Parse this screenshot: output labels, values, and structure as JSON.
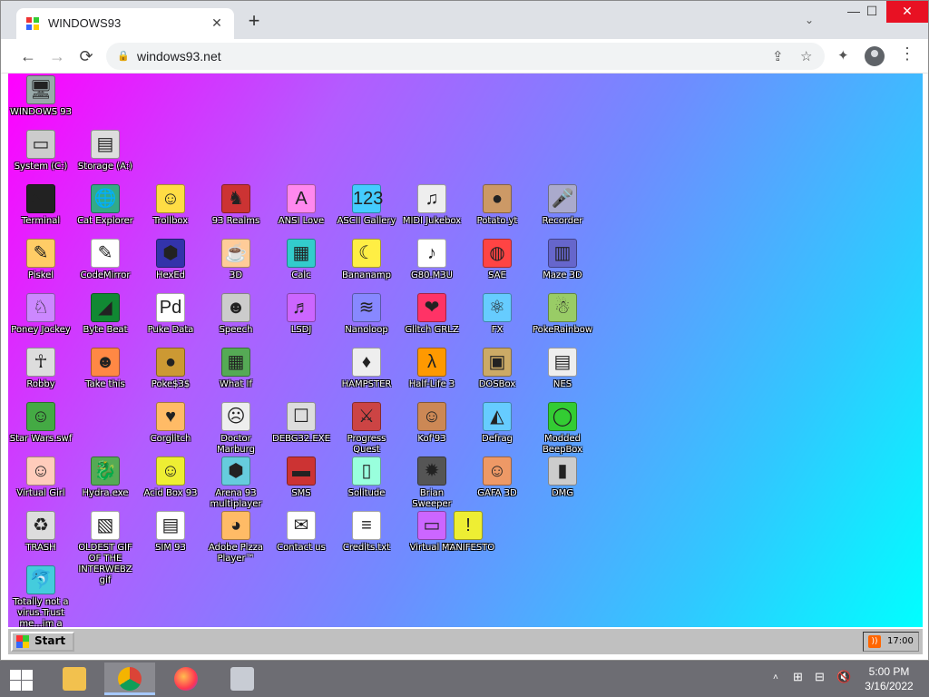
{
  "browser": {
    "tab_title": "WINDOWS93",
    "tab_close_glyph": "✕",
    "new_tab_glyph": "+",
    "tab_dropdown_glyph": "⌄",
    "url": "windows93.net",
    "window_controls": {
      "minimize": "—",
      "maximize": "☐",
      "close": "✕"
    },
    "nav": {
      "back": "←",
      "forward": "→",
      "reload": "⟳"
    },
    "icons": [
      "share-icon",
      "bookmark-star-icon",
      "extensions-icon",
      "profile-icon",
      "menu-kebab-icon"
    ],
    "glyphs": {
      "lock": "🔒",
      "share": "⇪",
      "star": "☆",
      "puzzle": "✦",
      "menu": "⋮"
    }
  },
  "desktop": {
    "background_colors": [
      "#ff00ff",
      "#00ffff"
    ],
    "icons": [
      {
        "label": "WINDOWS 93",
        "glyph": "🖥",
        "color": "#9aa"
      },
      {
        "label": "System (C:)",
        "glyph": "▭",
        "color": "#ccc"
      },
      {
        "label": "Storage (A:)",
        "glyph": "▤",
        "color": "#ddd"
      },
      {
        "label": "Terminal",
        "glyph": ">_",
        "color": "#222"
      },
      {
        "label": "Cat Explorer",
        "glyph": "🌐",
        "color": "#3a8"
      },
      {
        "label": "Trollbox",
        "glyph": "☺",
        "color": "#fd4"
      },
      {
        "label": "93 Realms",
        "glyph": "♞",
        "color": "#c33"
      },
      {
        "label": "ANSI Love",
        "glyph": "A",
        "color": "#f8e"
      },
      {
        "label": "ASCII Gallery",
        "glyph": "123",
        "color": "#4cf"
      },
      {
        "label": "MIDI Jukebox",
        "glyph": "♫",
        "color": "#eee"
      },
      {
        "label": "Potato.yt",
        "glyph": "●",
        "color": "#c96"
      },
      {
        "label": "Recorder",
        "glyph": "🎤",
        "color": "#aac"
      },
      {
        "label": "Piskel",
        "glyph": "✎",
        "color": "#fc6"
      },
      {
        "label": "CodeMirror",
        "glyph": "✎",
        "color": "#fff"
      },
      {
        "label": "HexEd",
        "glyph": "⬢",
        "color": "#33a"
      },
      {
        "label": "3D",
        "glyph": "☕",
        "color": "#fc9"
      },
      {
        "label": "Calc",
        "glyph": "▦",
        "color": "#3cc"
      },
      {
        "label": "Bananamp",
        "glyph": "☾",
        "color": "#fe4"
      },
      {
        "label": "G80.M3U",
        "glyph": "♪",
        "color": "#fff"
      },
      {
        "label": "SAE",
        "glyph": "◍",
        "color": "#f44"
      },
      {
        "label": "Maze 3D",
        "glyph": "▥",
        "color": "#66c"
      },
      {
        "label": "Poney Jockey",
        "glyph": "♘",
        "color": "#c8f"
      },
      {
        "label": "Byte Beat",
        "glyph": "◢",
        "color": "#183"
      },
      {
        "label": "Puke Data",
        "glyph": "Pd",
        "color": "#fff"
      },
      {
        "label": "Speech",
        "glyph": "☻",
        "color": "#ccc"
      },
      {
        "label": "LSDJ",
        "glyph": "♬",
        "color": "#c6f"
      },
      {
        "label": "Nanoloop",
        "glyph": "≋",
        "color": "#88f"
      },
      {
        "label": "Glitch GRLZ",
        "glyph": "❤",
        "color": "#f36"
      },
      {
        "label": "FX",
        "glyph": "⚛",
        "color": "#6cf"
      },
      {
        "label": "PokeRainbow",
        "glyph": "☃",
        "color": "#9c6"
      },
      {
        "label": "Robby",
        "glyph": "☥",
        "color": "#ddd"
      },
      {
        "label": "Take this",
        "glyph": "☻",
        "color": "#f84"
      },
      {
        "label": "Poke$3$",
        "glyph": "●",
        "color": "#c93"
      },
      {
        "label": "What If",
        "glyph": "▦",
        "color": "#5a5"
      },
      {
        "label": "HAMPSTER",
        "glyph": "♦",
        "color": "#eee"
      },
      {
        "label": "Half-Life 3",
        "glyph": "λ",
        "color": "#f90"
      },
      {
        "label": "DOSBox",
        "glyph": "▣",
        "color": "#ca6"
      },
      {
        "label": "NES",
        "glyph": "▤",
        "color": "#eee"
      },
      {
        "label": "Star Wars.swf",
        "glyph": "☺",
        "color": "#4a4"
      },
      {
        "label": "Corglitch",
        "glyph": "♥",
        "color": "#fb6"
      },
      {
        "label": "Doctor Marburg",
        "glyph": "☹",
        "color": "#eee"
      },
      {
        "label": "DEBG32.EXE",
        "glyph": "☐",
        "color": "#ddd"
      },
      {
        "label": "Progress Quest",
        "glyph": "⚔",
        "color": "#c44"
      },
      {
        "label": "Kof'93",
        "glyph": "☺",
        "color": "#c85"
      },
      {
        "label": "Defrag",
        "glyph": "◭",
        "color": "#6cf"
      },
      {
        "label": "Modded BeepBox",
        "glyph": "◯",
        "color": "#3c3"
      },
      {
        "label": "Virtual Girl",
        "glyph": "☺",
        "color": "#fcb"
      },
      {
        "label": "Hydra.exe",
        "glyph": "🐉",
        "color": "#5a5"
      },
      {
        "label": "Acid Box 93",
        "glyph": "☺",
        "color": "#ee3"
      },
      {
        "label": "Arena 93 multiplayer",
        "glyph": "⬢",
        "color": "#6cd"
      },
      {
        "label": "SMS",
        "glyph": "▬",
        "color": "#c33"
      },
      {
        "label": "Solitude",
        "glyph": "▯",
        "color": "#9fd"
      },
      {
        "label": "Brian Sweeper",
        "glyph": "✹",
        "color": "#555"
      },
      {
        "label": "GAFA 3D",
        "glyph": "☺",
        "color": "#e96"
      },
      {
        "label": "DMG",
        "glyph": "▮",
        "color": "#ccc"
      },
      {
        "label": "TRASH",
        "glyph": "♻",
        "color": "#ddd"
      },
      {
        "label": "OLDEST GIF OF THE INTERWEBZ gif",
        "glyph": "▧",
        "color": "#fff"
      },
      {
        "label": "SIM 93",
        "glyph": "▤",
        "color": "#fff"
      },
      {
        "label": "Adobe Pizza Player™",
        "glyph": "◕",
        "color": "#fb6"
      },
      {
        "label": "Contact us",
        "glyph": "✉",
        "color": "#fff"
      },
      {
        "label": "Credits.txt",
        "glyph": "≡",
        "color": "#fff"
      },
      {
        "label": "Virtual PC",
        "glyph": "▭",
        "color": "#c6f"
      },
      {
        "label": "MANIFESTO",
        "glyph": "!",
        "color": "#ee3"
      },
      {
        "label": "Totally not a virus.Trust me...im a",
        "glyph": "🐬",
        "color": "#4cd"
      }
    ]
  },
  "taskbar93": {
    "start_label": "Start",
    "rss_glyph": "))",
    "clock": "17:00"
  },
  "os_taskbar": {
    "apps": [
      "file-explorer",
      "chrome",
      "firefox",
      "remote-desktop"
    ],
    "app_glyphs": {
      "file-explorer": "▤",
      "chrome": "◉",
      "firefox": "●",
      "remote-desktop": "▣"
    },
    "tray_glyphs": {
      "overflow": "˄",
      "network": "⊞",
      "wifi": "⊟",
      "volume": "🔇"
    },
    "time": "5:00 PM",
    "date": "3/16/2022"
  }
}
